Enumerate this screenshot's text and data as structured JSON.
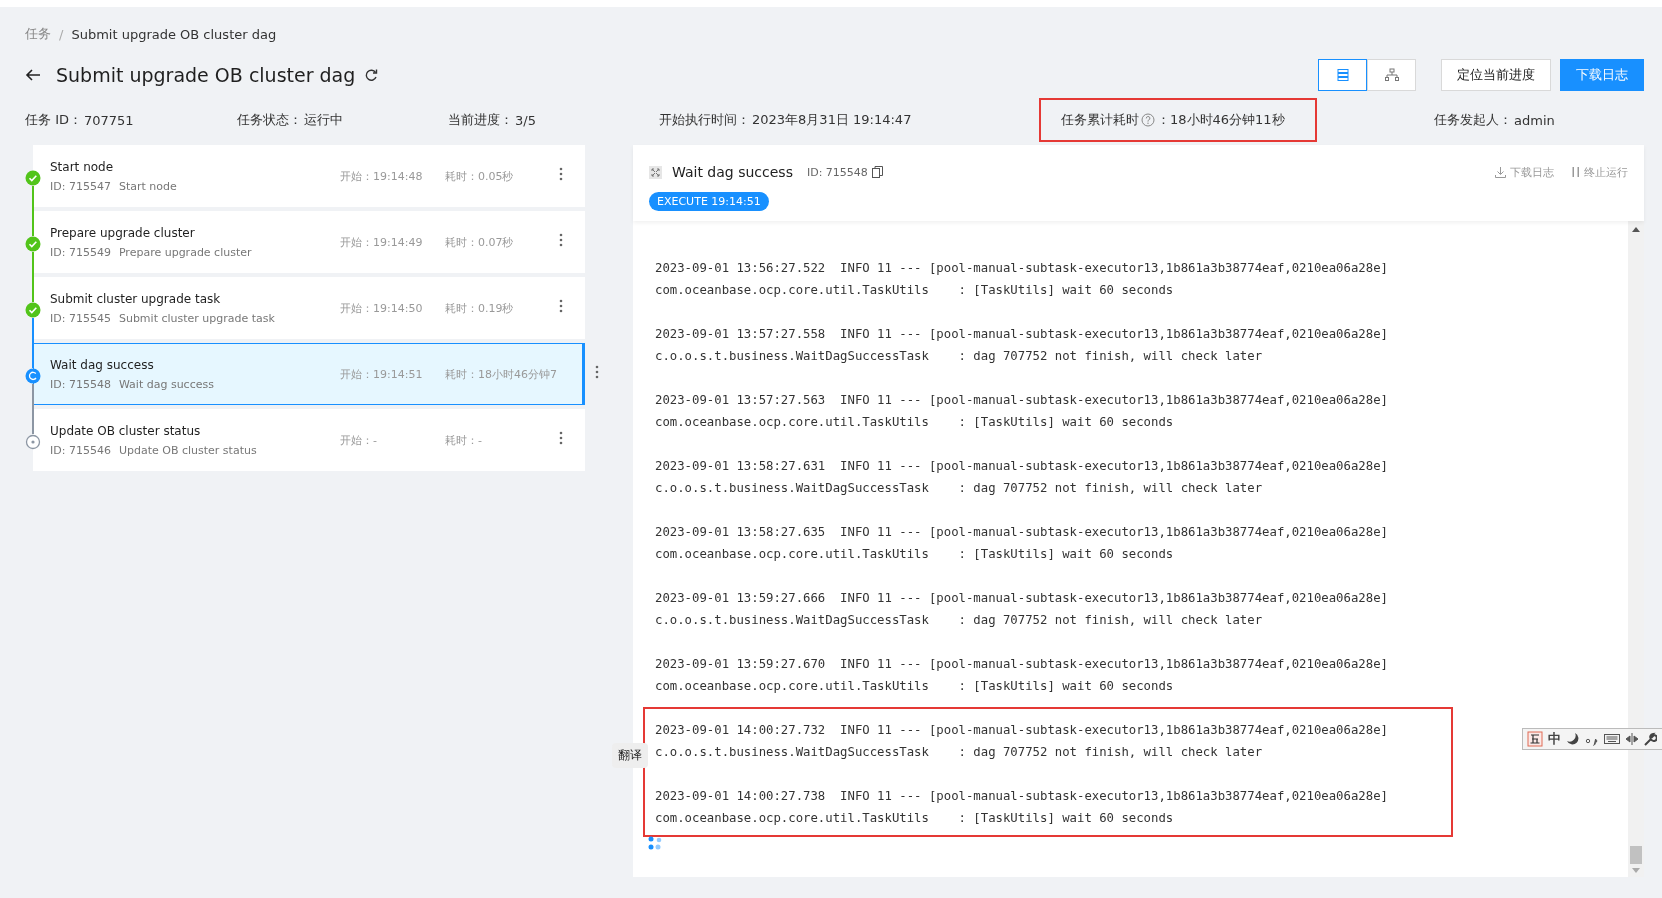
{
  "breadcrumb": [
    {
      "label": "任务",
      "link": true
    },
    {
      "label": "Submit upgrade OB cluster dag",
      "link": false
    }
  ],
  "breadcrumb_separator": "/",
  "title": "Submit upgrade OB cluster dag",
  "view_toggle": [
    {
      "kind": "list",
      "selected": true
    },
    {
      "kind": "tree",
      "selected": false
    }
  ],
  "buttons": [
    {
      "label": "定位当前进度",
      "primary": false
    },
    {
      "label": "下载日志",
      "primary": true
    }
  ],
  "info": [
    {
      "label": "任务 ID：",
      "value": "707751",
      "highlighted": false
    },
    {
      "label": "任务状态：",
      "value": "运行中",
      "highlighted": false
    },
    {
      "label": "当前进度：",
      "value": "3/5",
      "highlighted": false
    },
    {
      "label": "开始执行时间：",
      "value": "2023年8月31日 19:14:47",
      "highlighted": false
    },
    {
      "label": "任务累计耗时",
      "help": true,
      "value": "：18小时46分钟11秒",
      "highlighted": true
    },
    {
      "label": "任务发起人：",
      "value": "admin",
      "highlighted": false
    }
  ],
  "nodes": [
    {
      "title": "Start node",
      "id": "ID: 715547",
      "desc": "Start node",
      "start": "开始：19:14:48",
      "duration": "耗时：0.05秒",
      "kind": "done",
      "selected": false
    },
    {
      "title": "Prepare upgrade cluster",
      "id": "ID: 715549",
      "desc": "Prepare upgrade cluster",
      "start": "开始：19:14:49",
      "duration": "耗时：0.07秒",
      "kind": "done",
      "selected": false
    },
    {
      "title": "Submit cluster upgrade task",
      "id": "ID: 715545",
      "desc": "Submit cluster upgrade task",
      "start": "开始：19:14:50",
      "duration": "耗时：0.19秒",
      "kind": "done",
      "selected": false
    },
    {
      "title": "Wait dag success",
      "id": "ID: 715548",
      "desc": "Wait dag success",
      "start": "开始：19:14:51",
      "duration": "耗时：18小时46分钟7",
      "kind": "running",
      "selected": true
    },
    {
      "title": "Update OB cluster status",
      "id": "ID: 715546",
      "desc": "Update OB cluster status",
      "start": "开始：-",
      "duration": "耗时：-",
      "kind": "pending",
      "selected": false
    }
  ],
  "log_panel": {
    "title": "Wait dag success",
    "id": "ID: 715548",
    "actions": [
      {
        "kind": "download",
        "label": "下载日志"
      },
      {
        "kind": "stop",
        "label": "终止运行"
      }
    ],
    "badge": "EXECUTE 19:14:51",
    "entries": [
      {
        "line1": "2023-09-01 13:56:27.522  INFO 11 --- [pool-manual-subtask-executor13,1b861a3b38774eaf,0210ea06a28e]",
        "line2": "com.oceanbase.ocp.core.util.TaskUtils    : [TaskUtils] wait 60 seconds",
        "highlighted": false
      },
      {
        "line1": "2023-09-01 13:57:27.558  INFO 11 --- [pool-manual-subtask-executor13,1b861a3b38774eaf,0210ea06a28e]",
        "line2": "c.o.o.s.t.business.WaitDagSuccessTask    : dag 707752 not finish, will check later",
        "highlighted": false
      },
      {
        "line1": "2023-09-01 13:57:27.563  INFO 11 --- [pool-manual-subtask-executor13,1b861a3b38774eaf,0210ea06a28e]",
        "line2": "com.oceanbase.ocp.core.util.TaskUtils    : [TaskUtils] wait 60 seconds",
        "highlighted": false
      },
      {
        "line1": "2023-09-01 13:58:27.631  INFO 11 --- [pool-manual-subtask-executor13,1b861a3b38774eaf,0210ea06a28e]",
        "line2": "c.o.o.s.t.business.WaitDagSuccessTask    : dag 707752 not finish, will check later",
        "highlighted": false
      },
      {
        "line1": "2023-09-01 13:58:27.635  INFO 11 --- [pool-manual-subtask-executor13,1b861a3b38774eaf,0210ea06a28e]",
        "line2": "com.oceanbase.ocp.core.util.TaskUtils    : [TaskUtils] wait 60 seconds",
        "highlighted": false
      },
      {
        "line1": "2023-09-01 13:59:27.666  INFO 11 --- [pool-manual-subtask-executor13,1b861a3b38774eaf,0210ea06a28e]",
        "line2": "c.o.o.s.t.business.WaitDagSuccessTask    : dag 707752 not finish, will check later",
        "highlighted": false
      },
      {
        "line1": "2023-09-01 13:59:27.670  INFO 11 --- [pool-manual-subtask-executor13,1b861a3b38774eaf,0210ea06a28e]",
        "line2": "com.oceanbase.ocp.core.util.TaskUtils    : [TaskUtils] wait 60 seconds",
        "highlighted": false
      },
      {
        "line1": "2023-09-01 14:00:27.732  INFO 11 --- [pool-manual-subtask-executor13,1b861a3b38774eaf,0210ea06a28e]",
        "line2": "c.o.o.s.t.business.WaitDagSuccessTask    : dag 707752 not finish, will check later",
        "highlighted": true
      },
      {
        "line1": "2023-09-01 14:00:27.738  INFO 11 --- [pool-manual-subtask-executor13,1b861a3b38774eaf,0210ea06a28e]",
        "line2": "com.oceanbase.ocp.core.util.TaskUtils    : [TaskUtils] wait 60 seconds",
        "highlighted": true
      }
    ]
  },
  "translate_button": "翻译",
  "ime_toolbar": {
    "mode": "中"
  }
}
